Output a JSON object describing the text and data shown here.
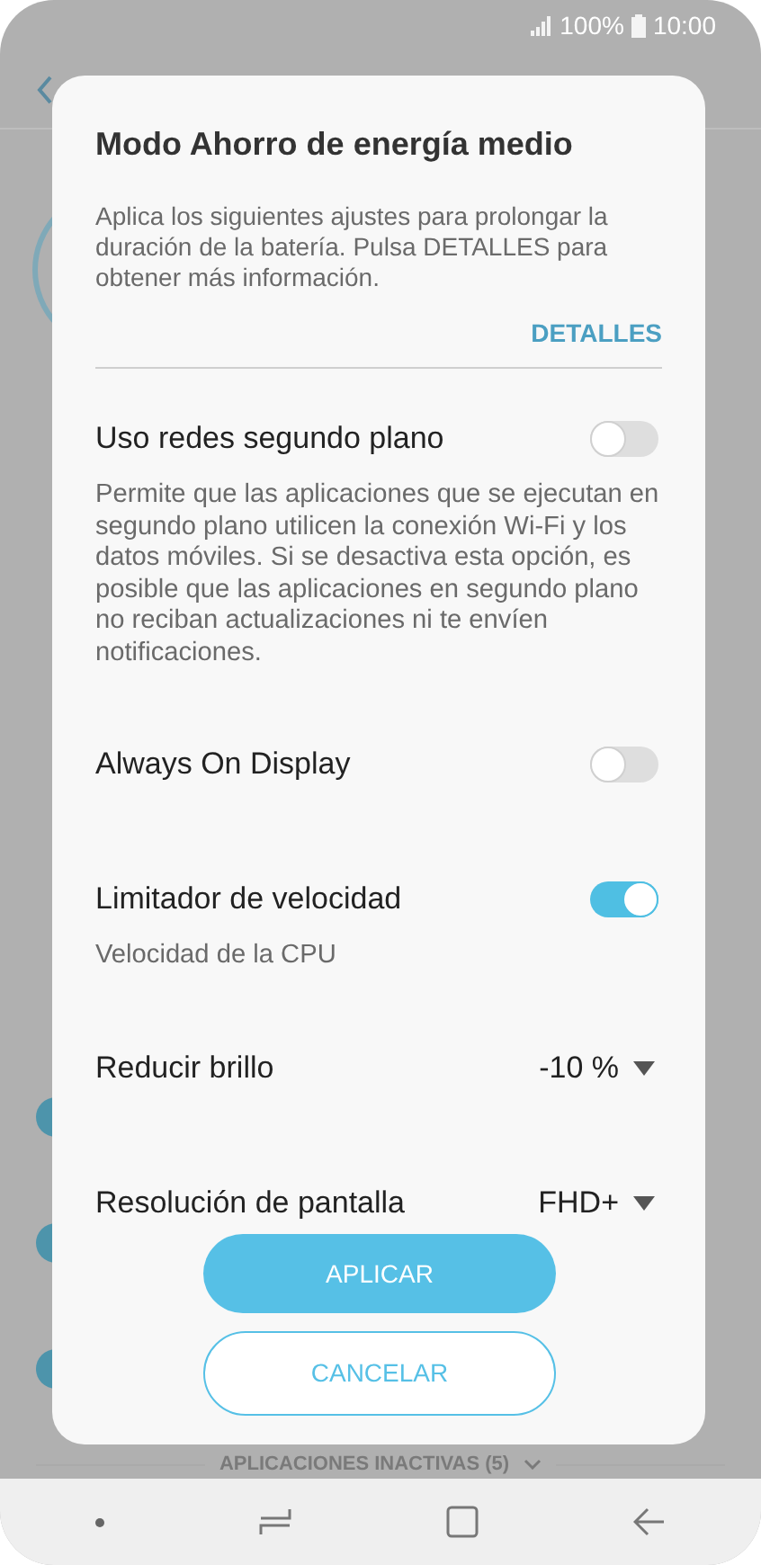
{
  "status_bar": {
    "battery": "100%",
    "time": "10:00"
  },
  "background": {
    "footer_label": "APLICACIONES INACTIVAS (5)"
  },
  "dialog": {
    "title": "Modo Ahorro de energía medio",
    "description": "Aplica los siguientes ajustes para prolongar la duración de la batería. Pulsa DETALLES para obtener más información.",
    "details_link": "DETALLES",
    "settings": [
      {
        "kind": "toggle",
        "label": "Uso redes segundo plano",
        "on": false,
        "description": "Permite que las aplicaciones que se ejecutan en segundo plano utilicen la conexión Wi-Fi y los datos móviles. Si se desactiva esta opción, es posible que las aplicaciones en segundo plano no reciban actualizaciones ni te envíen notificaciones."
      },
      {
        "kind": "toggle",
        "label": "Always On Display",
        "on": false
      },
      {
        "kind": "toggle",
        "label": "Limitador de velocidad",
        "on": true,
        "description": "Velocidad de la CPU"
      },
      {
        "kind": "dropdown",
        "label": "Reducir brillo",
        "value": "-10 %"
      },
      {
        "kind": "dropdown",
        "label": "Resolución de pantalla",
        "value": "FHD+"
      }
    ],
    "buttons": [
      {
        "kind": "primary",
        "label": "APLICAR"
      },
      {
        "kind": "outline",
        "label": "CANCELAR"
      }
    ]
  }
}
